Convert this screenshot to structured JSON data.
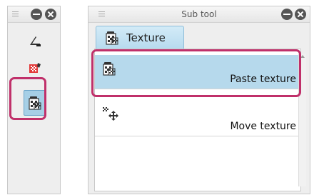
{
  "tool_palette": {
    "tools": [
      {
        "icon": "ruler-pen-icon"
      },
      {
        "icon": "pattern-fill-icon"
      },
      {
        "icon": "texture-icon",
        "selected": true
      }
    ]
  },
  "subtool_panel": {
    "title": "Sub tool",
    "tab_label": "Texture",
    "items": [
      {
        "label": "Paste texture",
        "icon": "paste-texture-icon",
        "selected": true
      },
      {
        "label": "Move texture",
        "icon": "move-texture-icon",
        "selected": false
      }
    ]
  },
  "colors": {
    "highlight": "#c0306a",
    "selection": "#b6d9ec"
  }
}
